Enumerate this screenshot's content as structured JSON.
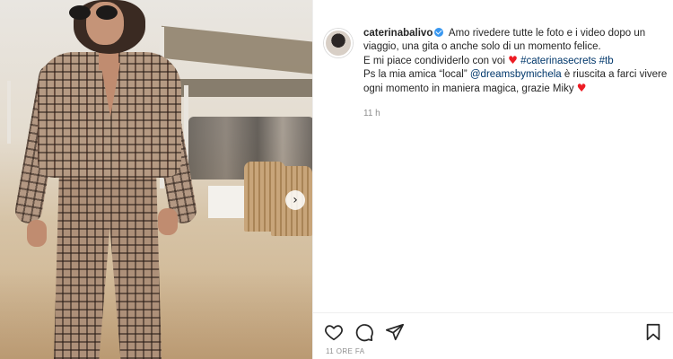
{
  "post": {
    "username": "caterinabalivo",
    "verified": true,
    "caption_line1": "Amo rivedere tutte le foto e i video dopo un viaggio, una gita o anche solo di un momento felice.",
    "caption_line2": "E mi piace condividerlo con voi",
    "hashtags": "#caterinasecrets #tb",
    "caption_line3_pre": "Ps la mia amica “local” ",
    "mention": "@dreamsbymichela",
    "caption_line3_post": " è riuscita a farci vivere ogni momento in maniera magica, grazie Miky",
    "heart_glyph": "♥",
    "age": "11 h",
    "timestamp": "11 ORE FA"
  },
  "icons": {
    "like": "heart-outline-icon",
    "comment": "comment-bubble-icon",
    "share": "paper-plane-icon",
    "save": "bookmark-icon",
    "next": "chevron-right-icon"
  },
  "colors": {
    "link": "#00376b",
    "verified": "#3897f0",
    "heart": "#ed1c24",
    "muted": "#8e8e8e"
  },
  "carousel": {
    "next_glyph": "›"
  }
}
